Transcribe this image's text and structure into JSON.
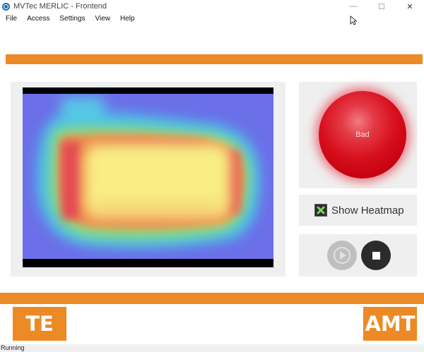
{
  "window": {
    "title": "MVTec MERLIC - Frontend",
    "controls": {
      "minimize_glyph": "—",
      "maximize_glyph": "☐",
      "close_glyph": "✕"
    }
  },
  "menu": {
    "items": [
      {
        "label": "File"
      },
      {
        "label": "Access"
      },
      {
        "label": "Settings"
      },
      {
        "label": "View"
      },
      {
        "label": "Help"
      }
    ]
  },
  "result": {
    "status_text": "Bad",
    "status_color": "#d80f1d"
  },
  "heatmap_toggle": {
    "label": "Show Heatmap",
    "icon": "heatmap-toggle-icon"
  },
  "controls": {
    "play_icon": "play-icon",
    "stop_icon": "stop-icon"
  },
  "logos": {
    "left": "TE",
    "right": "AMT"
  },
  "statusbar": {
    "text": "Running"
  },
  "colors": {
    "accent": "#ec8a25",
    "panel_bg": "#efefef"
  }
}
